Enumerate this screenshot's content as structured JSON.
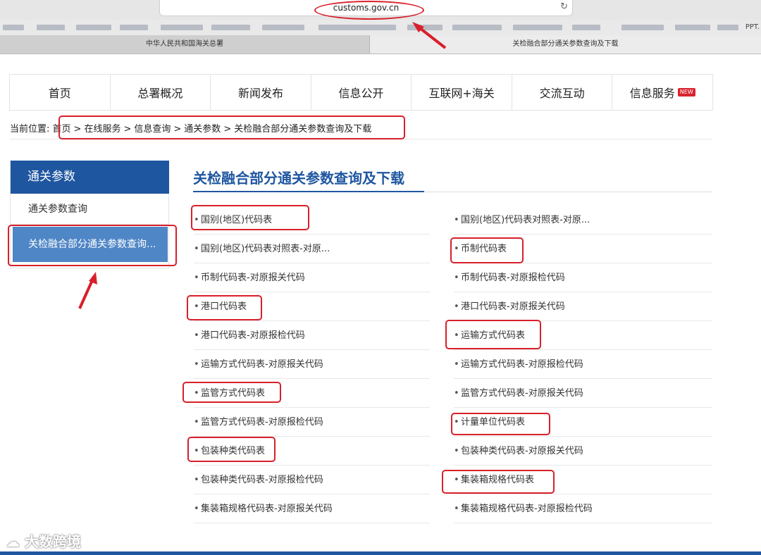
{
  "browser": {
    "url": "customs.gov.cn",
    "bookmark_trailing": "PPT.",
    "tabs": [
      {
        "label": "中华人民共和国海关总署",
        "active": false
      },
      {
        "label": "关检融合部分通关参数查询及下载",
        "active": true
      }
    ]
  },
  "nav": {
    "items": [
      {
        "label": "首页"
      },
      {
        "label": "总署概况"
      },
      {
        "label": "新闻发布"
      },
      {
        "label": "信息公开"
      },
      {
        "label": "互联网+海关"
      },
      {
        "label": "交流互动"
      },
      {
        "label": "信息服务",
        "badge": "NEW"
      }
    ]
  },
  "breadcrumb": {
    "prefix": "当前位置:",
    "items": [
      "首页",
      "在线服务",
      "信息查询",
      "通关参数",
      "关检融合部分通关参数查询及下载"
    ],
    "separator": ">"
  },
  "sidebar": {
    "header": "通关参数",
    "items": [
      {
        "label": "通关参数查询"
      },
      {
        "label": "关检融合部分通关参数查询..."
      }
    ]
  },
  "content": {
    "title": "关检融合部分通关参数查询及下载",
    "left_items": [
      "国别(地区)代码表",
      "国别(地区)代码表对照表-对原...",
      "币制代码表-对原报关代码",
      "港口代码表",
      "港口代码表-对原报检代码",
      "运输方式代码表-对原报关代码",
      "监管方式代码表",
      "监管方式代码表-对原报检代码",
      "包装种类代码表",
      "包装种类代码表-对原报检代码",
      "集装箱规格代码表-对原报关代码"
    ],
    "right_items": [
      "国别(地区)代码表对照表-对原...",
      "币制代码表",
      "币制代码表-对原报检代码",
      "港口代码表-对原报关代码",
      "运输方式代码表",
      "运输方式代码表-对原报检代码",
      "监管方式代码表-对原报关代码",
      "计量单位代码表",
      "包装种类代码表-对原报关代码",
      "集装箱规格代码表",
      "集装箱规格代码表-对原报检代码"
    ]
  },
  "watermark": "大数跨境",
  "colors": {
    "primary": "#1f56a0",
    "sidebar_active": "#4f86c6",
    "annotation_red": "#d8202a",
    "badge_red": "#d9232d"
  }
}
